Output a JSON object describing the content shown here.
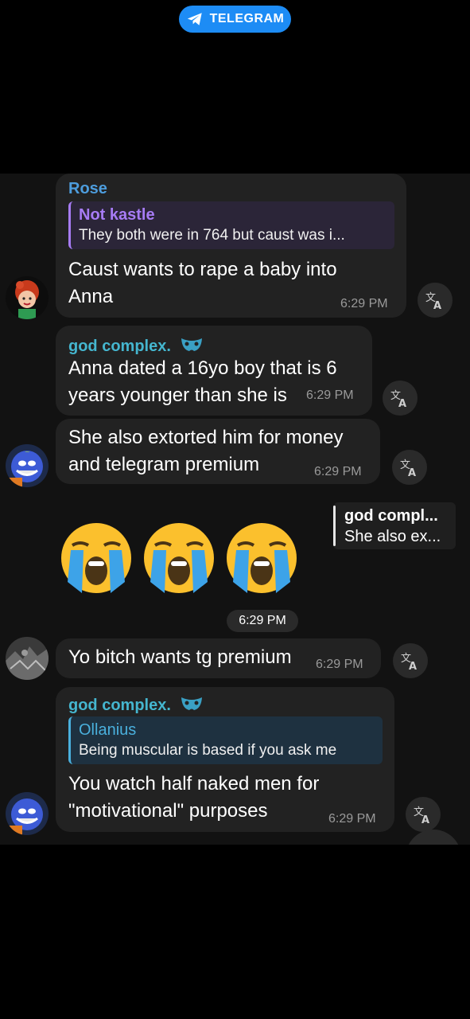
{
  "header": {
    "badge_label": "TELEGRAM"
  },
  "colors": {
    "accent": "#1d8cf5",
    "rose": "#4d9ddd",
    "not_kastle": "#a77cf5",
    "god_complex": "#45b6cf",
    "ollanius": "#4ab0dd"
  },
  "messages": [
    {
      "sender": "Rose",
      "reply": {
        "name": "Not kastle",
        "text": "They both were in 764 but caust was i..."
      },
      "lines": [
        "Caust wants to rape a baby into",
        "Anna"
      ],
      "time": "6:29 PM"
    },
    {
      "sender": "god complex.",
      "lines": [
        "Anna dated a 16yo boy that is 6",
        "years younger than she is"
      ],
      "time": "6:29 PM"
    },
    {
      "lines": [
        "She also extorted him for money",
        "and telegram premium"
      ],
      "time": "6:29 PM"
    },
    {
      "emoji_count": 3,
      "forwarded": {
        "name": "god compl...",
        "text": "She also ex..."
      },
      "date_pill": "6:29 PM"
    },
    {
      "lines": [
        "Yo bitch wants tg premium"
      ],
      "time": "6:29 PM"
    },
    {
      "sender": "god complex.",
      "reply": {
        "name": "Ollanius",
        "text": "Being muscular is based if you ask me"
      },
      "lines": [
        "You watch half naked men for",
        "\"motivational\" purposes"
      ],
      "time": "6:29 PM"
    }
  ]
}
